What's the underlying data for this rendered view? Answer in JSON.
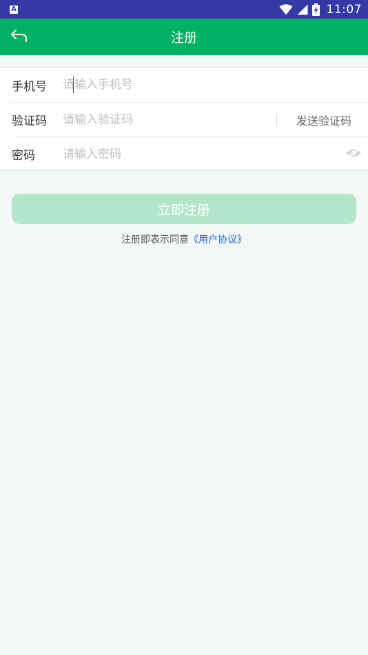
{
  "status_bar": {
    "app_badge": "A",
    "time": "11:07",
    "icons": [
      "wifi-icon",
      "signal-icon",
      "battery-charging-icon"
    ]
  },
  "toolbar": {
    "title": "注册",
    "back_icon": "back-arrow-icon"
  },
  "form": {
    "phone": {
      "label": "手机号",
      "placeholder": "请输入手机号",
      "value": ""
    },
    "code": {
      "label": "验证码",
      "placeholder": "请输入验证码",
      "value": "",
      "send_label": "发送验证码"
    },
    "password": {
      "label": "密码",
      "placeholder": "请输入密码",
      "value": "",
      "toggle_icon": "eye-icon"
    }
  },
  "submit": {
    "label": "立即注册"
  },
  "agreement": {
    "prefix": "注册即表示同意",
    "link": "《用户协议》"
  },
  "colors": {
    "status_bar": "#3539a6",
    "toolbar": "#00b064",
    "submit_disabled": "#b3e6c9",
    "link": "#1667d6",
    "background": "#f3f7f8"
  }
}
